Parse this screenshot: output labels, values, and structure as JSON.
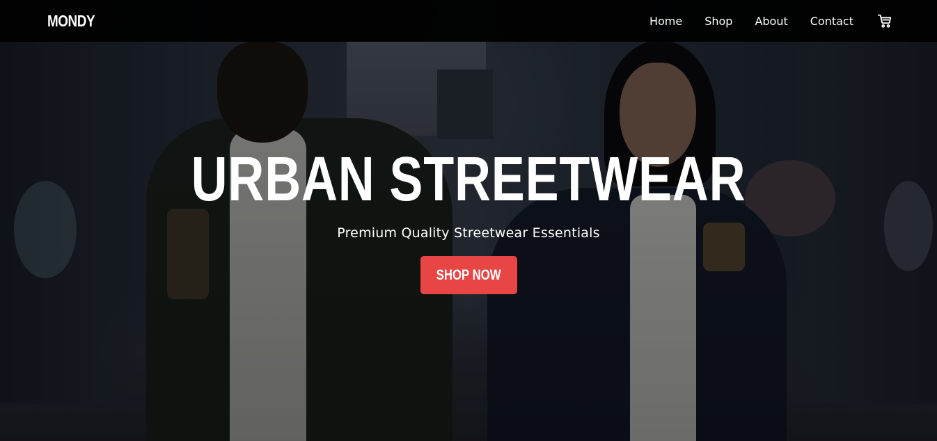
{
  "brand": {
    "logo": "MONDY"
  },
  "nav": {
    "items": [
      {
        "label": "Home"
      },
      {
        "label": "Shop"
      },
      {
        "label": "About"
      },
      {
        "label": "Contact"
      }
    ],
    "cart_icon": "shopping-cart-icon"
  },
  "hero": {
    "title": "URBAN STREETWEAR",
    "subtitle": "Premium Quality Streetwear Essentials",
    "cta_label": "SHOP NOW",
    "background": "urban-alley-photo"
  },
  "colors": {
    "accent": "#e84545",
    "navbar": "#000000",
    "text": "#ffffff"
  }
}
